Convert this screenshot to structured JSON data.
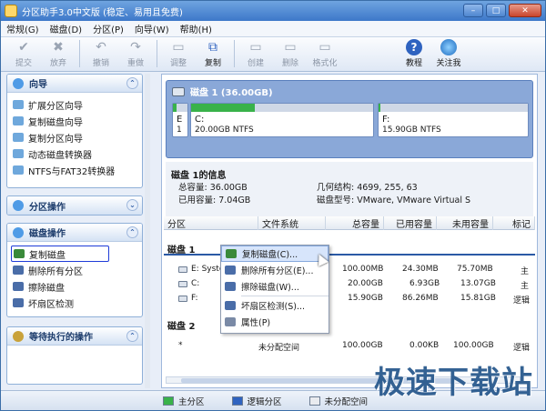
{
  "window": {
    "title": "分区助手3.0中文版 (稳定、易用且免费)"
  },
  "menu": [
    "常规(G)",
    "磁盘(D)",
    "分区(P)",
    "向导(W)",
    "帮助(H)"
  ],
  "toolbar": [
    {
      "label": "提交",
      "icon": "check-icon",
      "enabled": false
    },
    {
      "label": "放弃",
      "icon": "discard-icon",
      "enabled": false
    },
    {
      "label": "撤销",
      "icon": "undo-icon",
      "enabled": false
    },
    {
      "label": "重做",
      "icon": "redo-icon",
      "enabled": false
    },
    {
      "label": "调整",
      "icon": "resize-icon",
      "enabled": false
    },
    {
      "label": "复制",
      "icon": "copy-icon",
      "enabled": true
    },
    {
      "label": "创建",
      "icon": "create-icon",
      "enabled": false
    },
    {
      "label": "删除",
      "icon": "delete-icon",
      "enabled": false
    },
    {
      "label": "格式化",
      "icon": "format-icon",
      "enabled": false
    },
    {
      "label": "教程",
      "icon": "help-icon",
      "enabled": true
    },
    {
      "label": "关注我",
      "icon": "globe-icon",
      "enabled": true
    }
  ],
  "sidebar": {
    "wizard": {
      "title": "向导",
      "items": [
        "扩展分区向导",
        "复制磁盘向导",
        "复制分区向导",
        "动态磁盘转换器",
        "NTFS与FAT32转换器"
      ]
    },
    "partition_ops": {
      "title": "分区操作"
    },
    "disk_ops": {
      "title": "磁盘操作",
      "items": [
        "复制磁盘",
        "删除所有分区",
        "擦除磁盘",
        "坏扇区检测"
      ],
      "selected": 0
    },
    "pending": {
      "title": "等待执行的操作"
    }
  },
  "disk_header": {
    "title": "磁盘 1 (36.00GB)",
    "partitions": [
      {
        "letter": "E",
        "info": "1",
        "fill": 0.25
      },
      {
        "letter": "C:",
        "info": "20.00GB NTFS",
        "fill": 0.35
      },
      {
        "letter": "F:",
        "info": "15.90GB NTFS",
        "fill": 0.01
      }
    ]
  },
  "disk_info": {
    "title": "磁盘 1的信息",
    "total_label": "总容量: 36.00GB",
    "used_label": "已用容量: 7.04GB",
    "geometry_label": "几何结构: 4699, 255, 63",
    "model_label": "磁盘型号: VMware, VMware Virtual S"
  },
  "table": {
    "headers": [
      "分区",
      "文件系统",
      "总容量",
      "已用容量",
      "未用容量",
      "标记"
    ],
    "groups": [
      {
        "name": "磁盘 1",
        "rows": [
          {
            "part": "E: Syste",
            "fs": "",
            "total": "100.00MB",
            "used": "24.30MB",
            "free": "75.70MB",
            "flag": "主"
          },
          {
            "part": "C:",
            "fs": "",
            "total": "20.00GB",
            "used": "6.93GB",
            "free": "13.07GB",
            "flag": "主"
          },
          {
            "part": "F:",
            "fs": "",
            "total": "15.90GB",
            "used": "86.26MB",
            "free": "15.81GB",
            "flag": "逻辑"
          }
        ]
      },
      {
        "name": "磁盘 2",
        "rows": [
          {
            "part": "*",
            "fs": "未分配空间",
            "total": "100.00GB",
            "used": "0.00KB",
            "free": "100.00GB",
            "flag": "逻辑"
          }
        ]
      }
    ]
  },
  "context_menu": [
    "复制磁盘(C)...",
    "删除所有分区(E)...",
    "擦除磁盘(W)...",
    "坏扇区检测(S)...",
    "属性(P)"
  ],
  "status": {
    "legend": [
      "主分区",
      "逻辑分区",
      "未分配空间"
    ]
  },
  "watermark": "极速下载站",
  "colors": {
    "primary": "#39b24a",
    "logical": "#2f63c0",
    "unallocated": "#e9ebef",
    "accent": "#1e3bd8"
  }
}
